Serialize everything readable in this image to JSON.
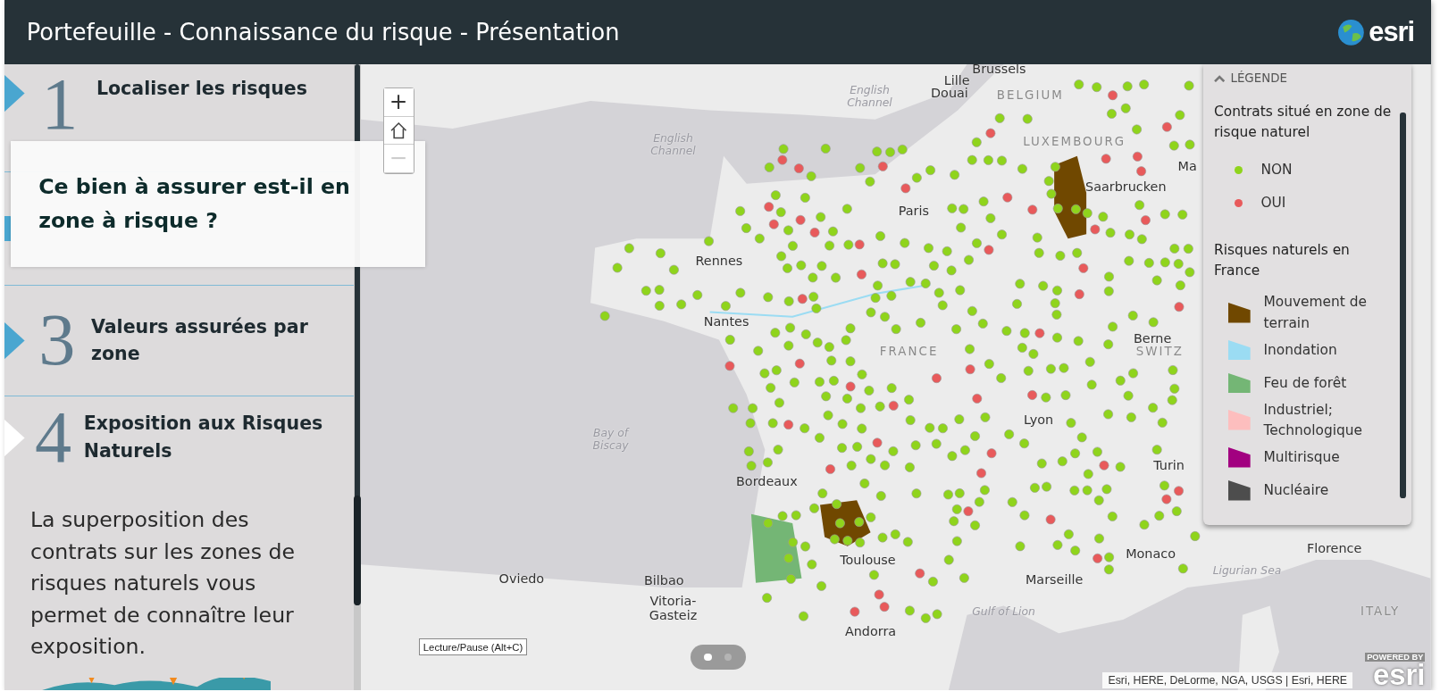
{
  "header": {
    "title": "Portefeuille - Connaissance du risque - Présentation",
    "logo": "esri"
  },
  "steps": [
    {
      "number": "1",
      "title": "Localiser les risques",
      "selected": false
    },
    {
      "selected": false
    },
    {
      "number": "3",
      "title": "Valeurs assurées par zone",
      "selected": false
    },
    {
      "number": "4",
      "title": "Exposition aux Risques Naturels",
      "selected": true
    }
  ],
  "description": "La superposition des contrats sur les zones de risques naturels vous permet de connaître leur exposition.",
  "popup": {
    "title": "Ce bien à assurer est-il en zone à risque ?"
  },
  "map": {
    "labels": [
      {
        "kind": "city",
        "text": "Brussels"
      },
      {
        "kind": "city",
        "text": "Lille"
      },
      {
        "kind": "city",
        "text": "Douai"
      },
      {
        "kind": "country",
        "text": "BELGIUM"
      },
      {
        "kind": "country",
        "text": "LUXEMBOURG"
      },
      {
        "kind": "water",
        "text": "English Channel"
      },
      {
        "kind": "water",
        "text": "English Channel"
      },
      {
        "kind": "city",
        "text": "Saarbrucken"
      },
      {
        "kind": "city",
        "text": "Ma"
      },
      {
        "kind": "city",
        "text": "Paris"
      },
      {
        "kind": "city",
        "text": "Rennes"
      },
      {
        "kind": "city",
        "text": "Nantes"
      },
      {
        "kind": "country",
        "text": "FRANCE"
      },
      {
        "kind": "city",
        "text": "Berne"
      },
      {
        "kind": "country",
        "text": "SWITZ"
      },
      {
        "kind": "water",
        "text": "Bay of Biscay"
      },
      {
        "kind": "city",
        "text": "Lyon"
      },
      {
        "kind": "city",
        "text": "Bordeaux"
      },
      {
        "kind": "city",
        "text": "Turin"
      },
      {
        "kind": "city",
        "text": "Toulouse"
      },
      {
        "kind": "city",
        "text": "Marseille"
      },
      {
        "kind": "city",
        "text": "Monaco"
      },
      {
        "kind": "city",
        "text": "Florence"
      },
      {
        "kind": "water",
        "text": "Ligurian Sea"
      },
      {
        "kind": "country",
        "text": "ITALY"
      },
      {
        "kind": "city",
        "text": "Oviedo"
      },
      {
        "kind": "city",
        "text": "Bilbao"
      },
      {
        "kind": "city",
        "text": "Vitoria-Gasteiz"
      },
      {
        "kind": "city",
        "text": "Andorra"
      },
      {
        "kind": "water",
        "text": "Gulf of Lion"
      }
    ],
    "zoom": {
      "zoom_in": "+",
      "zoom_out": "−",
      "zoom_out_disabled": true
    },
    "tooltip": "Lecture/Pause (Alt+C)",
    "pager": [
      {
        "selected": true
      },
      {
        "selected": false
      }
    ],
    "attribution": "Esri, HERE, DeLorme, NGA, USGS | Esri, HERE",
    "powered_by": "POWERED BY",
    "powered_logo": "esri"
  },
  "legend": {
    "title": "LÉGENDE",
    "expanded": true,
    "sections": [
      {
        "title": "Contrats situé en zone de risque naturel",
        "items": [
          {
            "kind": "dot",
            "label": "NON",
            "color": "#8fd41c"
          },
          {
            "kind": "dot",
            "label": "OUI",
            "color": "#e85a5b"
          }
        ]
      },
      {
        "title": "Risques naturels en France",
        "items": [
          {
            "kind": "swatch",
            "label": "Mouvement de terrain",
            "color": "#704800"
          },
          {
            "kind": "swatch",
            "label": "Inondation",
            "color": "#9bdcf3"
          },
          {
            "kind": "swatch",
            "label": "Feu de forêt",
            "color": "#74b675"
          },
          {
            "kind": "swatch",
            "label": "Industriel; Technologique",
            "color": "#fdbebe"
          },
          {
            "kind": "swatch",
            "label": "Multirisque",
            "color": "#a20080"
          },
          {
            "kind": "swatch",
            "label": "Nucléaire",
            "color": "#4d4d4d"
          }
        ]
      }
    ]
  }
}
